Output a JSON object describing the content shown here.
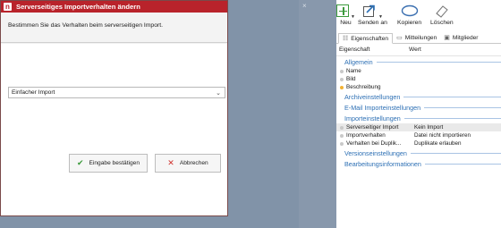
{
  "dialog": {
    "title": "Serverseitiges Importverhalten ändern",
    "app_icon_letter": "n",
    "description": "Bestimmen Sie das Verhalten beim serverseitigen Import.",
    "select_value": "Einfacher Import",
    "confirm_label": "Eingabe bestätigen",
    "cancel_label": "Abbrechen"
  },
  "window": {
    "close_glyph": "×"
  },
  "toolbar": {
    "new_label": "Neu",
    "send_label": "Senden an",
    "copy_label": "Kopieren",
    "delete_label": "Löschen"
  },
  "tabs": [
    {
      "label": "Eigenschaften",
      "icon": "properties-icon"
    },
    {
      "label": "Mitteilungen",
      "icon": "messages-icon"
    },
    {
      "label": "Mitglieder",
      "icon": "members-icon"
    }
  ],
  "grid": {
    "col_property": "Eigenschaft",
    "col_value": "Wert"
  },
  "sections": {
    "allgemein": "Allgemein",
    "archiv": "Archiveinstellungen",
    "email": "E-Mail Importeinstellungen",
    "import": "Importeinstellungen",
    "version": "Versionseinstellungen",
    "bearbeitung": "Bearbeitungsinformationen"
  },
  "allgemein_rows": [
    {
      "name": "Name",
      "value": ""
    },
    {
      "name": "Bild",
      "value": ""
    },
    {
      "name": "Beschreibung",
      "value": ""
    }
  ],
  "import_rows": [
    {
      "name": "Serverseitiger Import",
      "value": "Kein Import"
    },
    {
      "name": "Importverhalten",
      "value": "Datei nicht importieren"
    },
    {
      "name": "Verhalten bei Duplik...",
      "value": "Duplikate erlauben"
    }
  ],
  "colors": {
    "titlebar": "#b9232b",
    "section_blue": "#2c6fb4",
    "required_bullet": "#f2b233",
    "check_green": "#3b9a3b",
    "cancel_red": "#d0312d"
  }
}
